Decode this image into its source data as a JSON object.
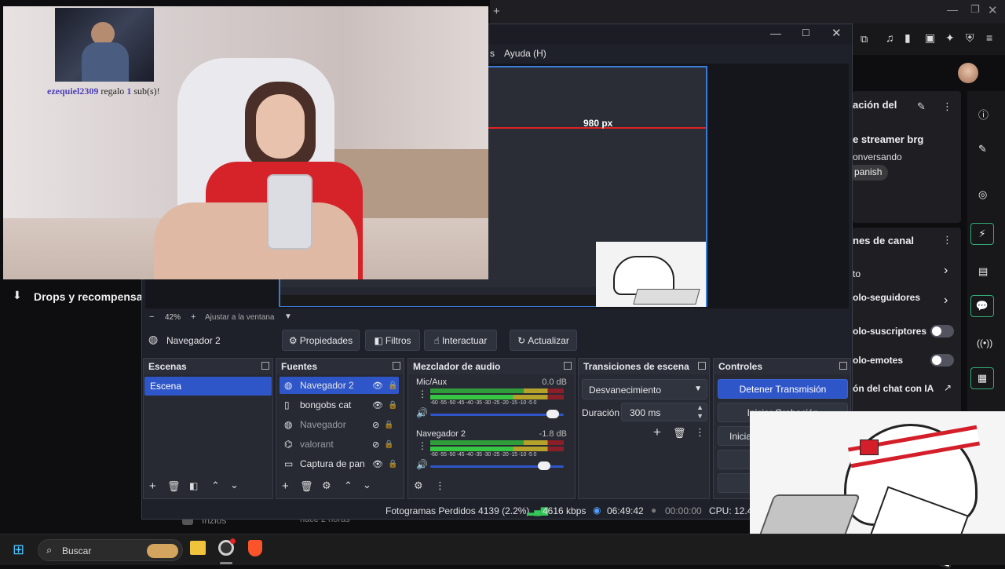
{
  "browser": {
    "plus": "+"
  },
  "twitch": {
    "sidebar_drops": "Drops y recompensas",
    "info_title": "ación del",
    "stream_title": "e streamer brg",
    "category": "onversando",
    "language_tag": "panish",
    "channel_title": "nes de canal",
    "items": [
      "to",
      "olo-seguidores",
      "olo-suscriptores",
      "olo-emotes",
      "ón del chat con IA"
    ],
    "recent_item": "Inzios",
    "recent_time": "hace 2 horas"
  },
  "alert": {
    "user": "ezequiel2309",
    "text": " regalo ",
    "count": "1",
    "suffix": " sub(s)!"
  },
  "obs": {
    "menu_help": "Ayuda (H)",
    "menu_prefix": "s",
    "preview_px_label": "980 px",
    "zoom": "42%",
    "zoom_minus": "−",
    "zoom_plus": "+",
    "fit_label": "Ajustar a la ventana",
    "selected_source": "Navegador 2",
    "toolbar": {
      "properties": "Propiedades",
      "filters": "Filtros",
      "interact": "Interactuar",
      "refresh": "Actualizar"
    },
    "scenes": {
      "title": "Escenas",
      "items": [
        "Escena"
      ]
    },
    "sources": {
      "title": "Fuentes",
      "items": [
        {
          "name": "Navegador 2",
          "icon": "globe-icon",
          "visible": true
        },
        {
          "name": "bongobs cat",
          "icon": "file-icon",
          "visible": true
        },
        {
          "name": "Navegador",
          "icon": "globe-icon",
          "visible": false
        },
        {
          "name": "valorant",
          "icon": "gamepad-icon",
          "visible": false
        },
        {
          "name": "Captura de pan",
          "icon": "monitor-icon",
          "visible": true
        }
      ]
    },
    "mixer": {
      "title": "Mezclador de audio",
      "ticks": "-60 -55 -50 -45 -40 -35 -30 -25 -20 -15 -10 -5 0",
      "channels": [
        {
          "name": "Mic/Aux",
          "db": "0.0 dB",
          "volume": 0.92
        },
        {
          "name": "Navegador 2",
          "db": "-1.8 dB",
          "volume": 0.85
        }
      ]
    },
    "transitions": {
      "title": "Transiciones de escena",
      "selected": "Desvanecimiento",
      "duration_label": "Duración",
      "duration_value": "300 ms"
    },
    "controls": {
      "title": "Controles",
      "stop_stream": "Detener Transmisión",
      "start_rec": "Iniciar Grabación",
      "virtual_cam": "Inicia"
    },
    "status": {
      "dropped": "Fotogramas Perdidos 4139 (2.2%)",
      "bitrate": "4616 kbps",
      "stream_time": "06:49:42",
      "rec_time": "00:00:00",
      "cpu": "CPU: 12.4"
    }
  },
  "taskbar": {
    "search": "Buscar"
  },
  "colors": {
    "accent": "#2f56c8",
    "live": "#35c759",
    "twitch_purple": "#9147ff"
  }
}
